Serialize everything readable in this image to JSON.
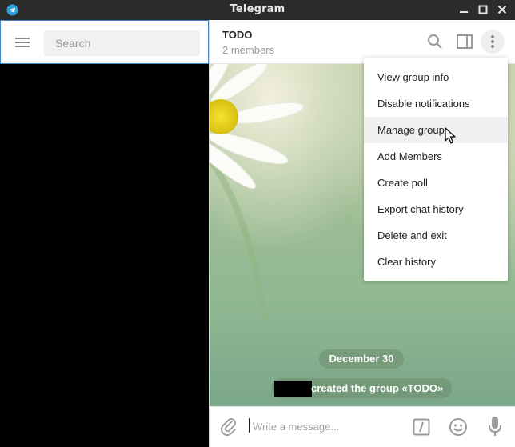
{
  "window": {
    "title": "Telegram"
  },
  "sidebar": {
    "search_placeholder": "Search"
  },
  "chat": {
    "name": "TODO",
    "subtitle": "2 members",
    "date_label": "December 30",
    "service_message": "created the group «TODO»"
  },
  "composer": {
    "placeholder": "Write a message..."
  },
  "menu": {
    "items": [
      "View group info",
      "Disable notifications",
      "Manage group",
      "Add Members",
      "Create poll",
      "Export chat history",
      "Delete and exit",
      "Clear history"
    ],
    "hovered_index": 2
  },
  "colors": {
    "accent": "#3f86c7",
    "titlebar": "#2b2b2b",
    "menu_hover": "#f0f0f0"
  }
}
